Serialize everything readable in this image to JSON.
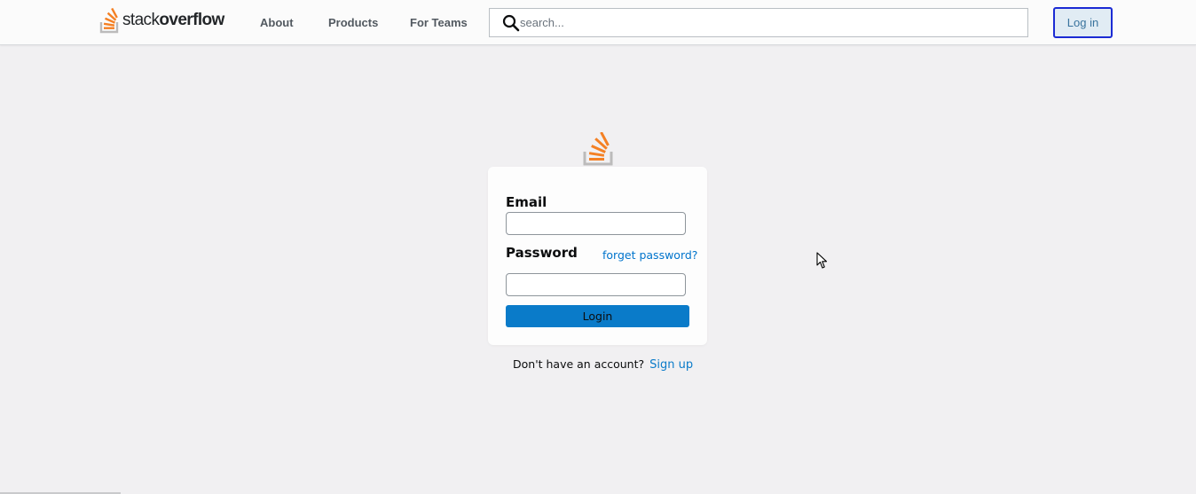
{
  "header": {
    "logo": {
      "word_light": "stack",
      "word_bold": "overflow",
      "icon": "stack-overflow-logo-icon"
    },
    "nav": [
      {
        "label": "About"
      },
      {
        "label": "Products"
      },
      {
        "label": "For Teams"
      }
    ],
    "search": {
      "placeholder": "search...",
      "value": "",
      "icon": "search-icon"
    },
    "login_button": "Log in"
  },
  "login_form": {
    "email_label": "Email",
    "email_value": "",
    "password_label": "Password",
    "password_value": "",
    "forgot_link": "forget password?",
    "submit_label": "Login"
  },
  "signup": {
    "prompt": "Don't have an account?",
    "link": "Sign up"
  },
  "colors": {
    "brand_orange": "#f48024",
    "tray_gray": "#bcbbbb",
    "primary_blue": "#0a7bc9",
    "link_blue": "#0074cc",
    "page_background": "#f1f0f2"
  }
}
